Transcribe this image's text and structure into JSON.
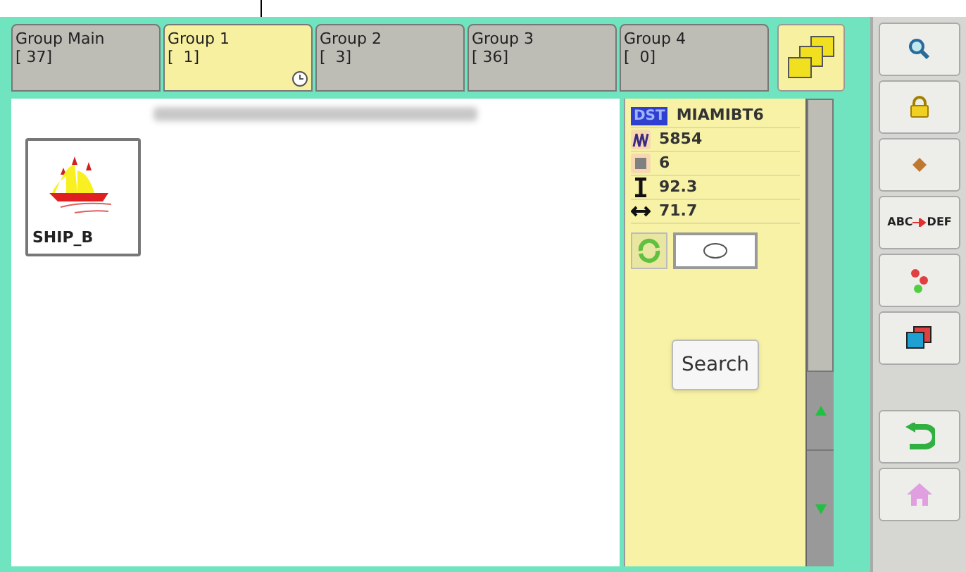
{
  "tabs": [
    {
      "label": "Group Main",
      "count": "[ 37]",
      "selected": false,
      "clock": false
    },
    {
      "label": "Group 1",
      "count": "[  1]",
      "selected": true,
      "clock": true
    },
    {
      "label": "Group 2",
      "count": "[  3]",
      "selected": false,
      "clock": false
    },
    {
      "label": "Group 3",
      "count": "[ 36]",
      "selected": false,
      "clock": false
    },
    {
      "label": "Group 4",
      "count": "[  0]",
      "selected": false,
      "clock": false
    }
  ],
  "designs": [
    {
      "name": "SHIP_B"
    }
  ],
  "info": {
    "format": "DST",
    "rows": [
      {
        "kind": "name",
        "value": "MIAMIBT6"
      },
      {
        "kind": "stitches",
        "value": "5854"
      },
      {
        "kind": "colors",
        "value": "6"
      },
      {
        "kind": "height",
        "value": "92.3"
      },
      {
        "kind": "width",
        "value": "71.7"
      }
    ],
    "search_button": "Search"
  },
  "side_buttons": [
    {
      "kind": "search"
    },
    {
      "kind": "lock"
    },
    {
      "kind": "point"
    },
    {
      "kind": "text"
    },
    {
      "kind": "flowers"
    },
    {
      "kind": "layers"
    },
    {
      "kind": "gap"
    },
    {
      "kind": "back"
    },
    {
      "kind": "home"
    }
  ],
  "side_text": {
    "from": "ABC",
    "to": "DEF"
  }
}
